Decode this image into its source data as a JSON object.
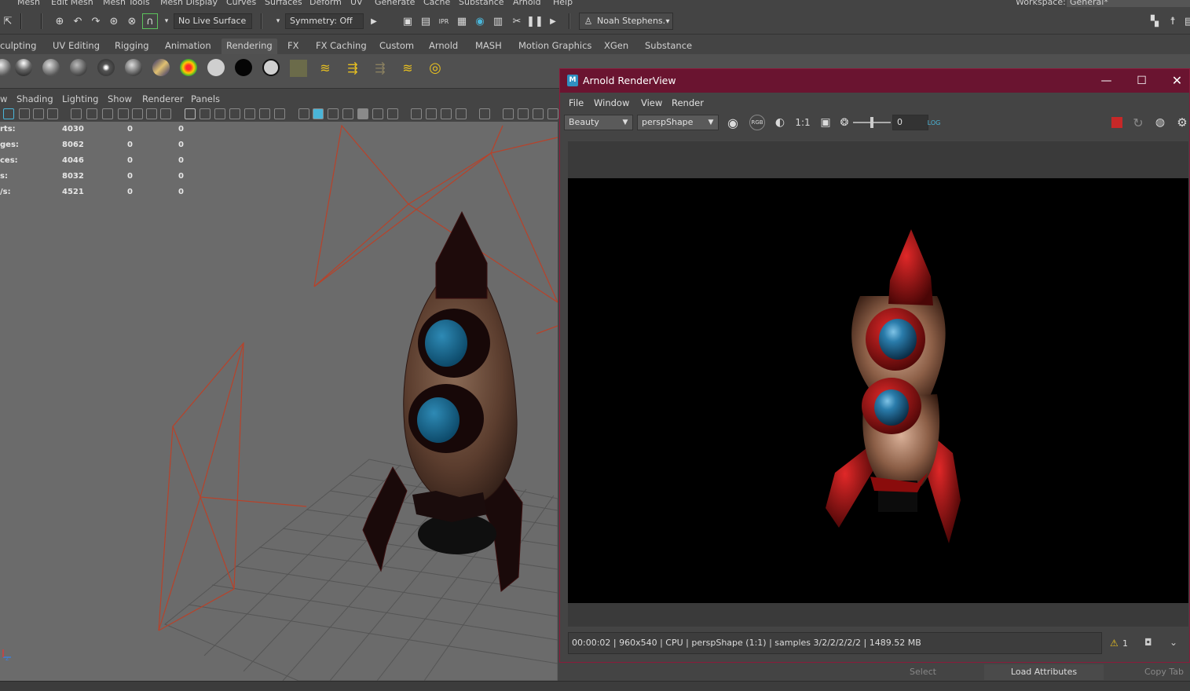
{
  "main_menu": [
    "Mesh",
    "Edit Mesh",
    "Mesh Tools",
    "Mesh Display",
    "Curves",
    "Surfaces",
    "Deform",
    "UV",
    "Generate",
    "Cache",
    "Substance",
    "Arnold",
    "Help"
  ],
  "workspace": {
    "label": "Workspace:",
    "value": "General*"
  },
  "status_line": {
    "live_surface": "No Live Surface",
    "symmetry": "Symmetry: Off",
    "user": "Noah Stephens."
  },
  "shelf_tabs": [
    "culpting",
    "UV Editing",
    "Rigging",
    "Animation",
    "Rendering",
    "FX",
    "FX Caching",
    "Custom",
    "Arnold",
    "MASH",
    "Motion Graphics",
    "XGen",
    "Substance"
  ],
  "shelf_active_tab": "Rendering",
  "panel_menu": [
    "w",
    "Shading",
    "Lighting",
    "Show",
    "Renderer",
    "Panels"
  ],
  "hud": {
    "rows": [
      {
        "label": "rts:",
        "v1": "4030",
        "v2": "0",
        "v3": "0"
      },
      {
        "label": "ges:",
        "v1": "8062",
        "v2": "0",
        "v3": "0"
      },
      {
        "label": "ces:",
        "v1": "4046",
        "v2": "0",
        "v3": "0"
      },
      {
        "label": "s:",
        "v1": "8032",
        "v2": "0",
        "v3": "0"
      },
      {
        "label": "/s:",
        "v1": "4521",
        "v2": "0",
        "v3": "0"
      }
    ]
  },
  "renderview": {
    "title": "Arnold RenderView",
    "logo_letter": "M",
    "menu": [
      "File",
      "Window",
      "View",
      "Render"
    ],
    "aov": "Beauty",
    "camera": "perspShape",
    "ratio": "1:1",
    "exposure": "0",
    "status": "00:00:02 | 960x540 | CPU | perspShape (1:1) | samples 3/2/2/2/2/2 | 1489.52 MB",
    "warnings": "1",
    "log_label": "LOG"
  },
  "attribute_editor_bar": {
    "select": "Select",
    "load": "Load Attributes",
    "copy_tab": "Copy Tab"
  },
  "colors": {
    "title_bar": "#6a1430",
    "accent_wire": "#b8422a",
    "rocket_red": "#b01a1a",
    "window_blue": "#1e6f9a"
  }
}
